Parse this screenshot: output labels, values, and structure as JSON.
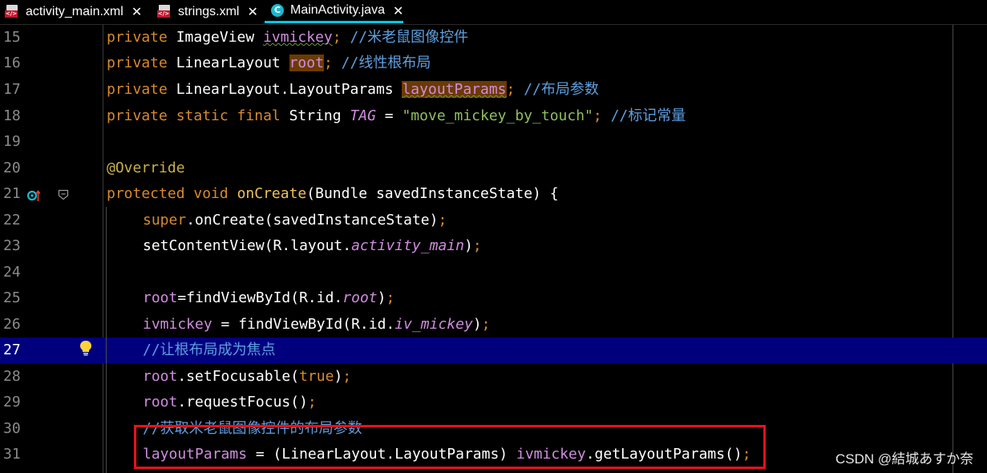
{
  "tabs": [
    {
      "label": "activity_main.xml",
      "icon": "xml-file-icon",
      "active": false
    },
    {
      "label": "strings.xml",
      "icon": "xml-file-icon",
      "active": false
    },
    {
      "label": "MainActivity.java",
      "icon": "java-class-icon",
      "active": true
    }
  ],
  "close_glyph": "✕",
  "editor": {
    "line_numbers": [
      "15",
      "16",
      "17",
      "18",
      "19",
      "20",
      "21",
      "22",
      "23",
      "24",
      "25",
      "26",
      "27",
      "28",
      "29",
      "30",
      "31"
    ],
    "current_line": "27",
    "lines": {
      "l15": {
        "kw": "private ",
        "type": "ImageView ",
        "field": "ivmickey",
        "semi": "; ",
        "comment": "//米老鼠图像控件"
      },
      "l16": {
        "kw": "private ",
        "type": "LinearLayout ",
        "field": "root",
        "semi": "; ",
        "comment": "//线性根布局"
      },
      "l17": {
        "kw": "private ",
        "type": "LinearLayout.LayoutParams ",
        "field": "layoutParams",
        "semi": "; ",
        "comment": "//布局参数"
      },
      "l18": {
        "kw": "private static final ",
        "type": "String ",
        "field": "TAG",
        "eq": " = ",
        "str": "\"move_mickey_by_touch\"",
        "semi": "; ",
        "comment": "//标记常量"
      },
      "l20": {
        "annotation": "@Override"
      },
      "l21": {
        "kw": "protected void ",
        "method": "onCreate",
        "args": "(Bundle savedInstanceState) {"
      },
      "l22": {
        "kw": "super",
        "rest": ".onCreate(savedInstanceState)",
        "semi": ";"
      },
      "l23": {
        "call": "setContentView(R.layout.",
        "field": "activity_main",
        "end": ")",
        "semi": ";"
      },
      "l25": {
        "field": "root",
        "call": "=findViewById(R.id.",
        "field2": "root",
        "end": ")",
        "semi": ";"
      },
      "l26": {
        "field": "ivmickey",
        "call": " = findViewById(R.id.",
        "field2": "iv_mickey",
        "end": ")",
        "semi": ";"
      },
      "l27": {
        "comment": "//让根布局成为焦点"
      },
      "l28": {
        "field": "root",
        "call": ".setFocusable(",
        "kw": "true",
        "end": ")",
        "semi": ";"
      },
      "l29": {
        "field": "root",
        "call": ".requestFocus()",
        "semi": ";"
      },
      "l30": {
        "comment": "//获取米老鼠图像控件的布局参数"
      },
      "l31": {
        "field": "layoutParams",
        "call": " = (LinearLayout.LayoutParams) ",
        "field2": "ivmickey",
        "call2": ".getLayoutParams()",
        "semi": ";"
      }
    }
  },
  "watermark": "CSDN @結城あすか奈",
  "colors": {
    "background": "#000000",
    "keyword": "#d98a2b",
    "field": "#d08cde",
    "method": "#f0c05a",
    "string": "#8fbf5f",
    "comment": "#5e9fdf",
    "annotation": "#c9b04a",
    "current_line": "#00007f",
    "annotation_box": "#e8111a",
    "active_tab_underline": "#00c8e8"
  }
}
